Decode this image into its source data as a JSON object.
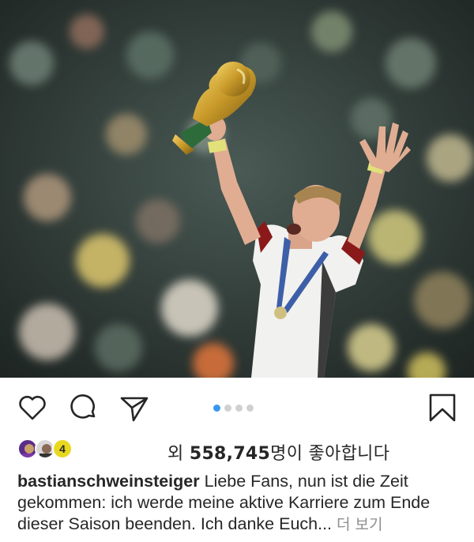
{
  "post": {
    "carousel": {
      "count": 4,
      "active": 0
    },
    "likes": {
      "prefix": "외 ",
      "count": "558,745",
      "suffix": "명이 좋아합니다",
      "avatar_badge": "4"
    },
    "caption": {
      "username": "bastianschweinsteiger",
      "text": " Liebe Fans, nun ist die Zeit gekommen: ich werde meine aktive Karriere zum Ende dieser Saison beenden. Ich danke Euch...",
      "more_label": "더 보기"
    }
  },
  "icons": {
    "like": "heart-icon",
    "comment": "comment-icon",
    "share": "send-icon",
    "save": "bookmark-icon"
  },
  "colors": {
    "accent": "#3897f0",
    "text": "#262626",
    "muted": "#8e8e8e"
  }
}
